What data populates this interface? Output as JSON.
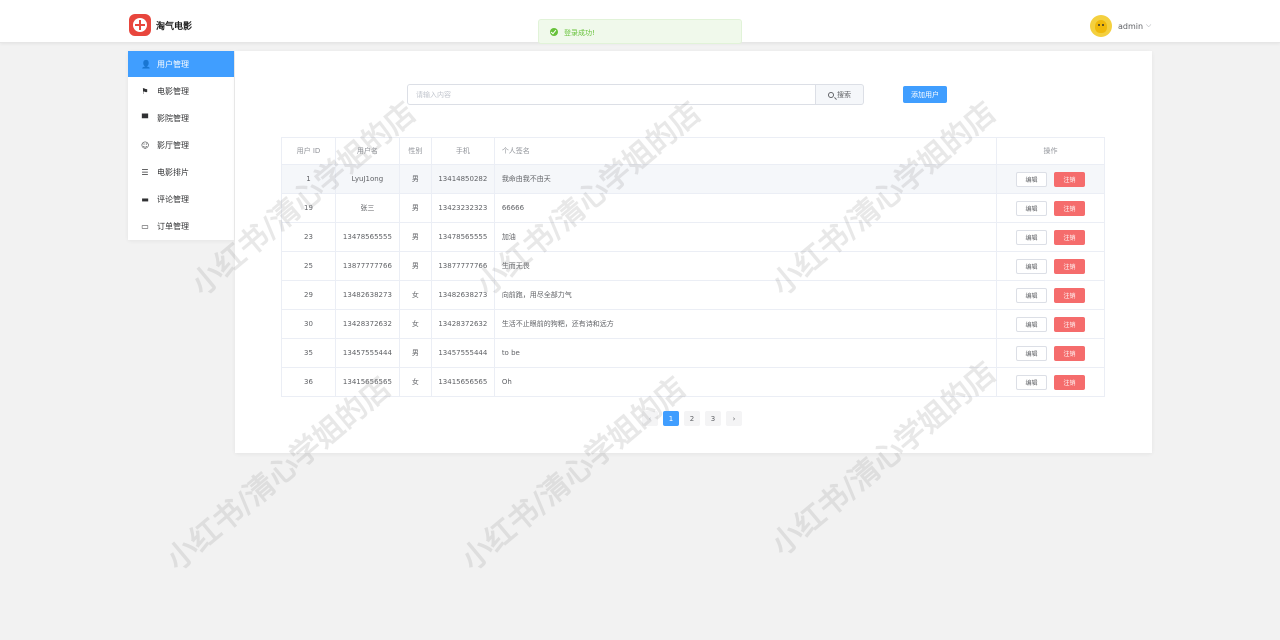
{
  "header": {
    "app_title": "淘气电影",
    "admin_name": "admin",
    "admin_arrow": "⌵"
  },
  "toast": {
    "message": "登录成功!",
    "color": "#67c23a"
  },
  "sidebar": {
    "items": [
      {
        "label": "用户管理",
        "icon": "user-icon",
        "glyph": "👤",
        "active": true
      },
      {
        "label": "电影管理",
        "icon": "flag-icon",
        "glyph": "⚑",
        "active": false
      },
      {
        "label": "影院管理",
        "icon": "cinema-icon",
        "glyph": "▀",
        "active": false
      },
      {
        "label": "影厅管理",
        "icon": "smile-icon",
        "glyph": "☺",
        "active": false
      },
      {
        "label": "电影排片",
        "icon": "list-icon",
        "glyph": "☰",
        "active": false
      },
      {
        "label": "评论管理",
        "icon": "comment-icon",
        "glyph": "▬",
        "active": false
      },
      {
        "label": "订单管理",
        "icon": "ticket-icon",
        "glyph": "▭",
        "active": false
      }
    ]
  },
  "search": {
    "placeholder": "请输入内容",
    "button_label": "搜索"
  },
  "add_button_label": "添加用户",
  "table": {
    "headers": [
      "用户 ID",
      "用户名",
      "性别",
      "手机",
      "个人签名",
      "操作"
    ],
    "edit_label": "编辑",
    "delete_label": "注销",
    "rows": [
      {
        "id": "1",
        "name": "LyuJ1ong",
        "sex": "男",
        "phone": "13414850282",
        "sign": "我命由我不由天",
        "highlighted": true
      },
      {
        "id": "19",
        "name": "张三",
        "sex": "男",
        "phone": "13423232323",
        "sign": "66666",
        "highlighted": false
      },
      {
        "id": "23",
        "name": "13478565555",
        "sex": "男",
        "phone": "13478565555",
        "sign": "加油",
        "highlighted": false
      },
      {
        "id": "25",
        "name": "13877777766",
        "sex": "男",
        "phone": "13877777766",
        "sign": "生而无畏",
        "highlighted": false
      },
      {
        "id": "29",
        "name": "13482638273",
        "sex": "女",
        "phone": "13482638273",
        "sign": "向前跑，用尽全部力气",
        "highlighted": false
      },
      {
        "id": "30",
        "name": "13428372632",
        "sex": "女",
        "phone": "13428372632",
        "sign": "生活不止眼前的狗粑，还有诗和远方",
        "highlighted": false
      },
      {
        "id": "35",
        "name": "13457555444",
        "sex": "男",
        "phone": "13457555444",
        "sign": "to be",
        "highlighted": false
      },
      {
        "id": "36",
        "name": "13415656565",
        "sex": "女",
        "phone": "13415656565",
        "sign": "Oh",
        "highlighted": false
      }
    ]
  },
  "pagination": {
    "prev": "‹",
    "next": "›",
    "pages": [
      "1",
      "2",
      "3"
    ],
    "current": "1"
  },
  "watermark_text": "小红书/清心学姐的店",
  "colors": {
    "primary": "#409eff",
    "danger": "#f56c6c",
    "success": "#67c23a",
    "brand": "#e8463d"
  }
}
